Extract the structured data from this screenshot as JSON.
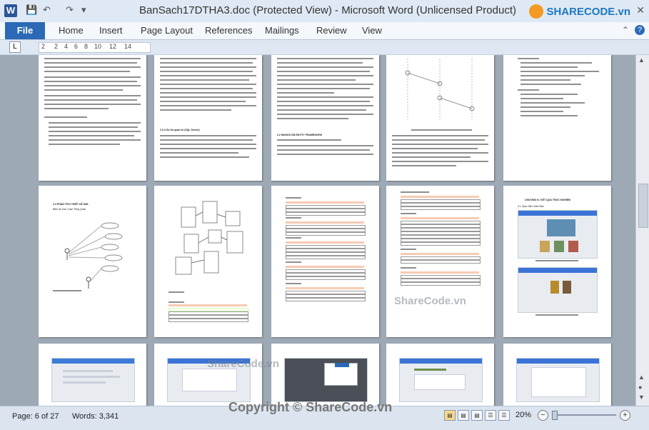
{
  "window": {
    "title": "BanSach17DTHA3.doc (Protected View)  -  Microsoft Word (Unlicensed Product)",
    "app_icon": "W",
    "brand": "SHARECODE.vn"
  },
  "ribbon": {
    "file_tab": "File",
    "tabs": [
      "Home",
      "Insert",
      "Page Layout",
      "References",
      "Mailings",
      "Review",
      "View"
    ]
  },
  "ruler": {
    "tab_selector": "L",
    "labels": [
      "2",
      "2",
      "4",
      "6",
      "8",
      "10",
      "12",
      "14"
    ]
  },
  "pages": {
    "p6_title": "2.4 PHÂN TÍCH THIẾT KẾ UML",
    "p6_sub": "Biểu đồ Use Case Tổng Quát",
    "p10_title": "CHƯƠNG IV. KẾT QUẢ THỰC NGHIỆM",
    "p10_sub": "4.1 Giao Diện Web Bán",
    "caption_p2": "2.3.3 Sơ đồ quan hệ (SQL Server)",
    "caption_p3": "2.2 MONGO DB ENTITY FRAMEWORK"
  },
  "status": {
    "page": "Page: 6 of 27",
    "words": "Words: 3,341",
    "zoom": "20%"
  },
  "watermark": {
    "bottom": "Copyright © ShareCode.vn",
    "middle_1": "ShareCode.vn",
    "middle_2": "ShareCode.vn"
  }
}
